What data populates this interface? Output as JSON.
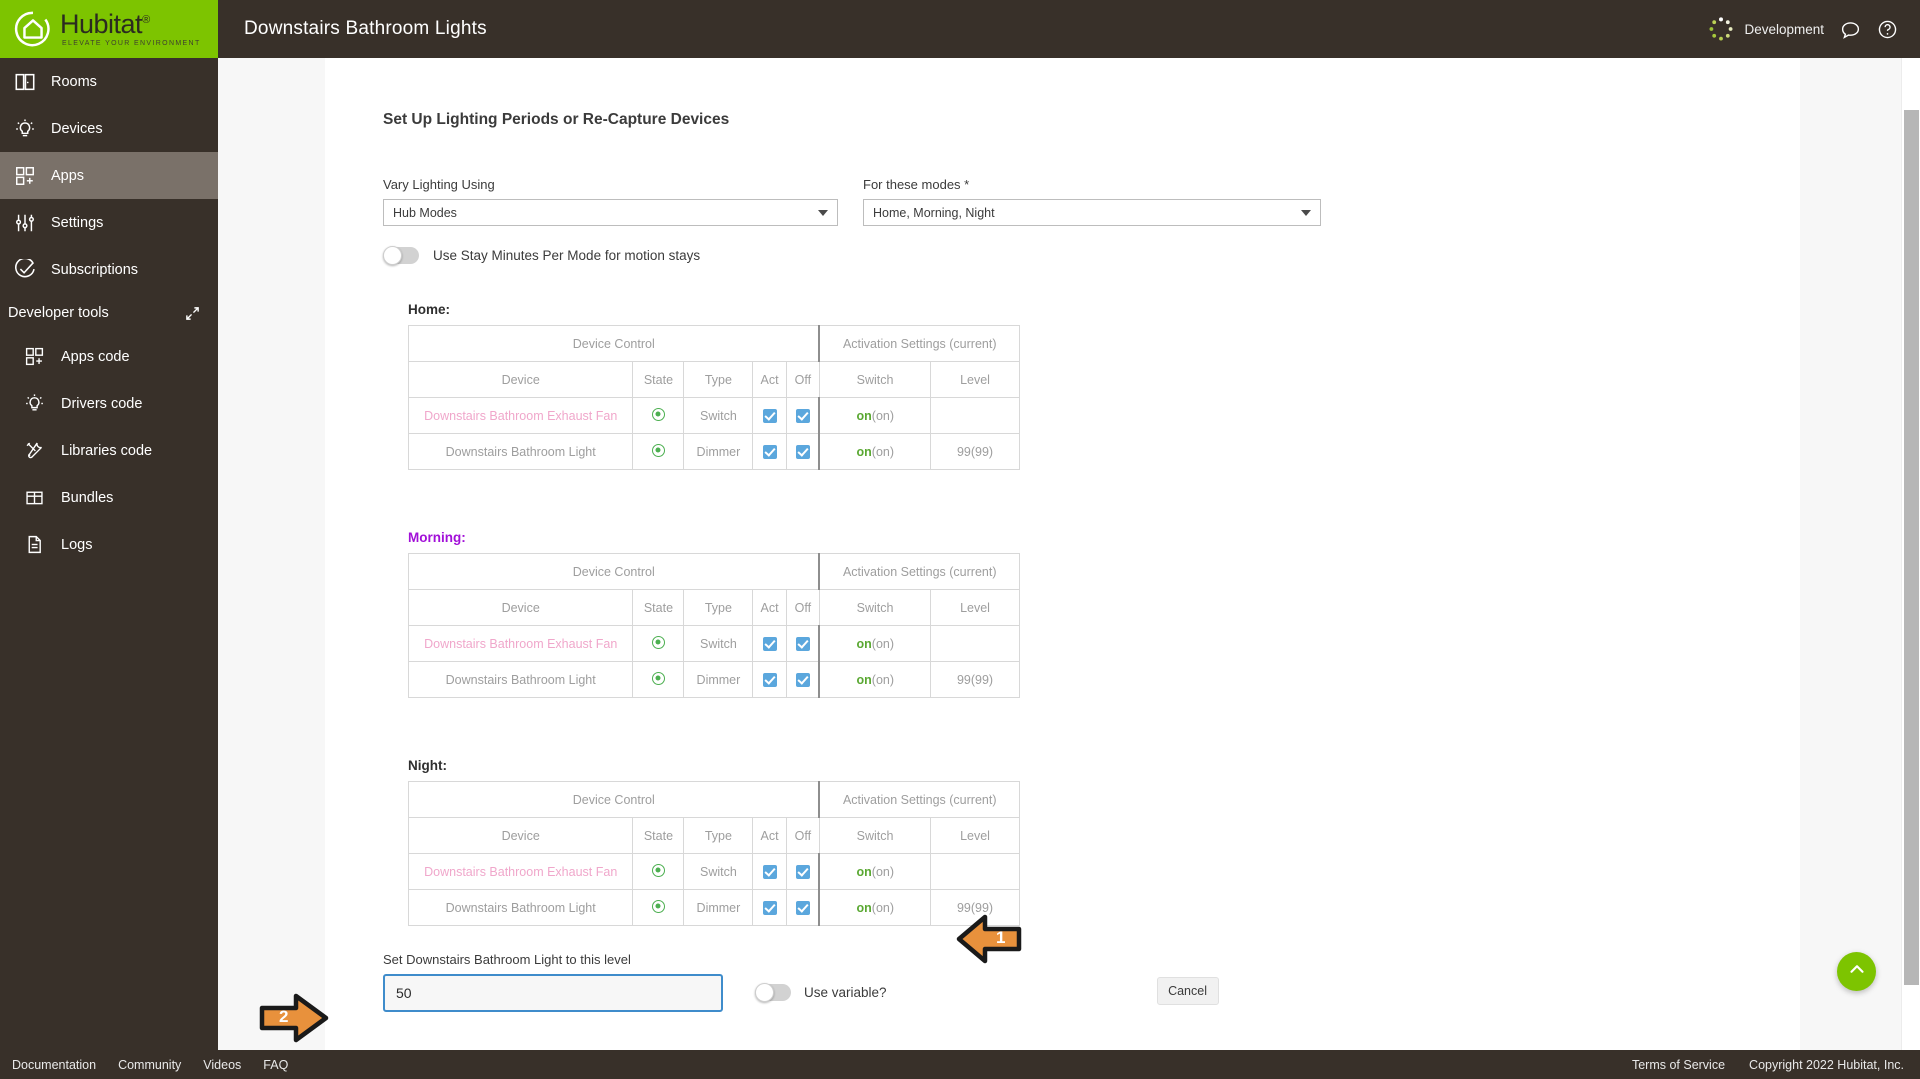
{
  "brand": {
    "name": "Hubitat",
    "tagline": "ELEVATE YOUR ENVIRONMENT",
    "logo_bg": "#7dc400"
  },
  "topbar": {
    "title": "Downstairs Bathroom Lights",
    "hub_name": "Development",
    "chat_icon": "chat-bubble-icon",
    "help_icon": "help-circle-icon"
  },
  "sidebar": {
    "items": [
      {
        "label": "Rooms",
        "icon": "rooms-icon",
        "active": false
      },
      {
        "label": "Devices",
        "icon": "lightbulb-icon",
        "active": false
      },
      {
        "label": "Apps",
        "icon": "apps-grid-icon",
        "active": true
      },
      {
        "label": "Settings",
        "icon": "sliders-icon",
        "active": false
      },
      {
        "label": "Subscriptions",
        "icon": "check-circle-icon",
        "active": false
      }
    ],
    "devtools_label": "Developer tools",
    "devtools_collapse_icon": "collapse-arrows-icon",
    "devtools_items": [
      {
        "label": "Apps code",
        "icon": "apps-grid-icon"
      },
      {
        "label": "Drivers code",
        "icon": "lightbulb-icon"
      },
      {
        "label": "Libraries code",
        "icon": "tools-icon"
      },
      {
        "label": "Bundles",
        "icon": "box-icon"
      },
      {
        "label": "Logs",
        "icon": "document-icon"
      }
    ]
  },
  "main": {
    "section_title": "Set Up Lighting Periods or Re-Capture Devices",
    "vary_lighting": {
      "label": "Vary Lighting Using",
      "value": "Hub Modes"
    },
    "for_modes": {
      "label": "For these modes *",
      "value": "Home, Morning, Night"
    },
    "stay_minutes_toggle": {
      "label": "Use Stay Minutes Per Mode for motion stays",
      "state": "off"
    },
    "table_headers": {
      "group_left": "Device Control",
      "group_right": "Activation Settings (current)",
      "device": "Device",
      "state": "State",
      "type": "Type",
      "act": "Act",
      "off": "Off",
      "switch": "Switch",
      "level": "Level"
    },
    "periods": [
      {
        "name": "Home:",
        "accent": false,
        "rows": [
          {
            "device": "Downstairs Bathroom Exhaust Fan",
            "state_icon": "radio-selected-icon",
            "type": "Switch",
            "act_checked": true,
            "off_checked": true,
            "switch_value": "on",
            "switch_current": "(on)",
            "level": ""
          },
          {
            "device": "Downstairs Bathroom Light",
            "state_icon": "radio-selected-icon",
            "type": "Dimmer",
            "act_checked": true,
            "off_checked": true,
            "switch_value": "on",
            "switch_current": "(on)",
            "level": "99(99)"
          }
        ]
      },
      {
        "name": "Morning:",
        "accent": true,
        "rows": [
          {
            "device": "Downstairs Bathroom Exhaust Fan",
            "state_icon": "radio-selected-icon",
            "type": "Switch",
            "act_checked": true,
            "off_checked": true,
            "switch_value": "on",
            "switch_current": "(on)",
            "level": ""
          },
          {
            "device": "Downstairs Bathroom Light",
            "state_icon": "radio-selected-icon",
            "type": "Dimmer",
            "act_checked": true,
            "off_checked": true,
            "switch_value": "on",
            "switch_current": "(on)",
            "level": "99(99)"
          }
        ]
      },
      {
        "name": "Night:",
        "accent": false,
        "rows": [
          {
            "device": "Downstairs Bathroom Exhaust Fan",
            "state_icon": "radio-selected-icon",
            "type": "Switch",
            "act_checked": true,
            "off_checked": true,
            "switch_value": "on",
            "switch_current": "(on)",
            "level": ""
          },
          {
            "device": "Downstairs Bathroom Light",
            "state_icon": "radio-selected-icon",
            "type": "Dimmer",
            "act_checked": true,
            "off_checked": true,
            "switch_value": "on",
            "switch_current": "(on)",
            "level": "99(99)"
          }
        ]
      }
    ],
    "level_form": {
      "label": "Set Downstairs Bathroom Light to this level",
      "value": "50",
      "placeholder": "",
      "use_variable_label": "Use variable?",
      "use_variable_state": "off",
      "cancel_label": "Cancel"
    },
    "scroll_top_icon": "chevron-up-icon"
  },
  "annotations": [
    {
      "number": "1",
      "color": "#E8913C",
      "target": "night-level-cell"
    },
    {
      "number": "2",
      "color": "#E8913C",
      "target": "level-input"
    }
  ],
  "footer": {
    "left_links": [
      "Documentation",
      "Community",
      "Videos",
      "FAQ"
    ],
    "right_links": [
      "Terms of Service",
      "Copyright 2022 Hubitat, Inc."
    ]
  },
  "colors": {
    "brand_green": "#7dc400",
    "dark_brown": "#383029",
    "accent_purple": "#a210d8",
    "link_pink": "#e07ab0",
    "checkbox_blue": "#5ba7dd",
    "radio_green": "#4caf50",
    "annotation_orange": "#E8913C",
    "input_focus_blue": "#3f8ccb"
  }
}
